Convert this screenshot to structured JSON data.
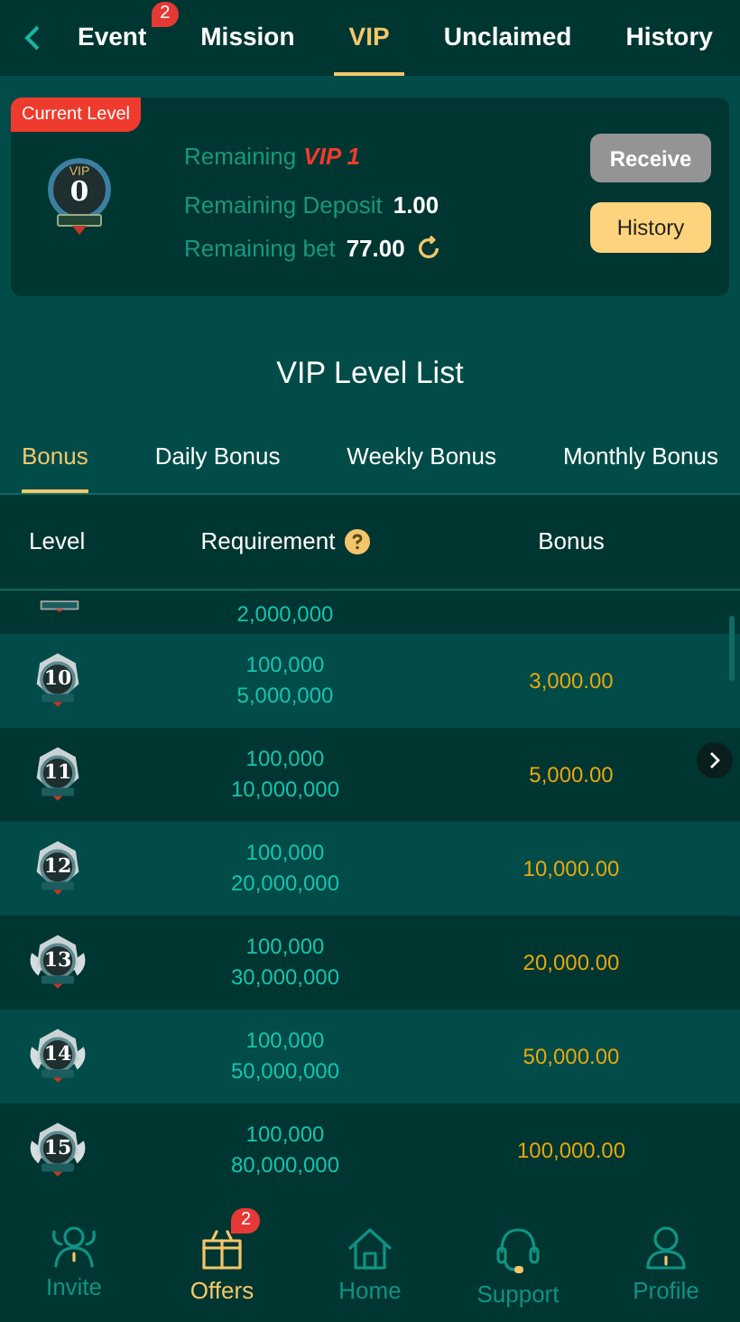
{
  "nav_tabs": [
    {
      "label": "Event",
      "badge": "2",
      "selected": false
    },
    {
      "label": "Mission",
      "selected": false
    },
    {
      "label": "VIP",
      "selected": true
    },
    {
      "label": "Unclaimed",
      "selected": false
    },
    {
      "label": "History",
      "selected": false
    }
  ],
  "current_level": {
    "tag": "Current Level",
    "badge_title": "VIP",
    "badge_level": "0",
    "remaining_label": "Remaining",
    "remaining_value": "VIP 1",
    "deposit_label": "Remaining Deposit",
    "deposit_value": "1.00",
    "bet_label": "Remaining bet",
    "bet_value": "77.00",
    "receive": "Receive",
    "history": "History"
  },
  "list_title": "VIP Level List",
  "bonus_tabs": [
    {
      "label": "Bonus",
      "selected": true
    },
    {
      "label": "Daily Bonus",
      "selected": false
    },
    {
      "label": "Weekly Bonus",
      "selected": false
    },
    {
      "label": "Monthly Bonus",
      "selected": false
    }
  ],
  "table": {
    "columns": [
      "Level",
      "Requirement",
      "Bonus"
    ],
    "rows": [
      {
        "kind": "partial",
        "requirement": [
          "2,000,000"
        ]
      },
      {
        "kind": "full",
        "level": "10",
        "requirement": [
          "100,000",
          "5,000,000"
        ],
        "bonus": "3,000.00"
      },
      {
        "kind": "full",
        "level": "11",
        "requirement": [
          "100,000",
          "10,000,000"
        ],
        "bonus": "5,000.00"
      },
      {
        "kind": "full",
        "level": "12",
        "requirement": [
          "100,000",
          "20,000,000"
        ],
        "bonus": "10,000.00"
      },
      {
        "kind": "full",
        "level": "13",
        "requirement": [
          "100,000",
          "30,000,000"
        ],
        "bonus": "20,000.00"
      },
      {
        "kind": "full",
        "level": "14",
        "requirement": [
          "100,000",
          "50,000,000"
        ],
        "bonus": "50,000.00"
      },
      {
        "kind": "full",
        "level": "15",
        "requirement": [
          "100,000",
          "80,000,000"
        ],
        "bonus": "100,000.00"
      }
    ]
  },
  "bottom_nav": [
    {
      "label": "Invite",
      "kind": "people",
      "selected": false
    },
    {
      "label": "Offers",
      "kind": "gift",
      "badge": "2",
      "selected": true
    },
    {
      "label": "Home",
      "kind": "home",
      "selected": false
    },
    {
      "label": "Support",
      "kind": "headset",
      "selected": false
    },
    {
      "label": "Profile",
      "kind": "person",
      "selected": false
    }
  ]
}
